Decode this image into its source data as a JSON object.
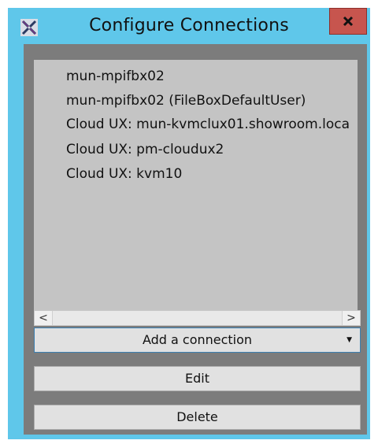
{
  "window": {
    "title": "Configure Connections",
    "close_icon": "close-icon",
    "app_icon": "app-logo-icon"
  },
  "connections": [
    "mun-mpifbx02",
    "mun-mpifbx02 (FileBoxDefaultUser)",
    "Cloud UX: mun-kvmclux01.showroom.loca",
    "Cloud UX: pm-cloudux2",
    "Cloud UX: kvm10"
  ],
  "scrollbar": {
    "left_glyph": "<",
    "right_glyph": ">"
  },
  "buttons": {
    "add": "Add a connection",
    "add_arrow": "▼",
    "edit": "Edit",
    "delete": "Delete"
  },
  "colors": {
    "title_bar": "#5fc7ea",
    "close_button": "#c7554e",
    "client_background": "#7c7c7c",
    "list_background": "#c4c4c4"
  }
}
